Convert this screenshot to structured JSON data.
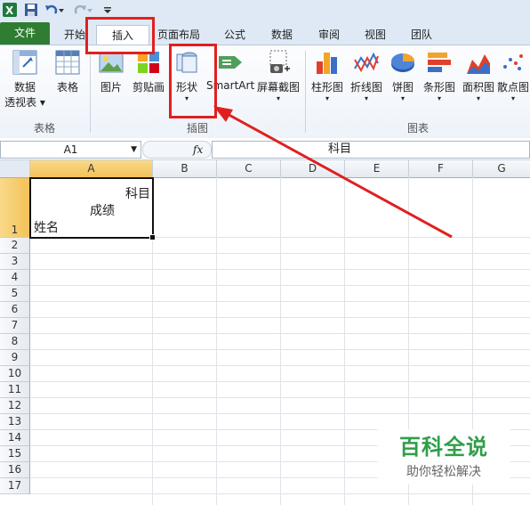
{
  "qat": {
    "icons": [
      "excel-logo-icon",
      "save-icon",
      "undo-icon",
      "redo-icon",
      "customize-icon"
    ]
  },
  "ribbon_tabs": [
    {
      "label": "文件"
    },
    {
      "label": "开始"
    },
    {
      "label": "插入"
    },
    {
      "label": "页面布局"
    },
    {
      "label": "公式"
    },
    {
      "label": "数据"
    },
    {
      "label": "审阅"
    },
    {
      "label": "视图"
    },
    {
      "label": "团队"
    }
  ],
  "ribbon": {
    "groups": [
      {
        "label": "表格",
        "buttons": [
          {
            "line1": "数据",
            "line2": "透视表 ▾"
          },
          {
            "line1": "表格",
            "line2": ""
          }
        ]
      },
      {
        "label": "插图",
        "buttons": [
          {
            "line1": "图片"
          },
          {
            "line1": "剪贴画"
          },
          {
            "line1": "形状",
            "line2": "▾"
          },
          {
            "line1": "SmartArt"
          },
          {
            "line1": "屏幕截图",
            "line2": "▾"
          }
        ]
      },
      {
        "label": "图表",
        "buttons": [
          {
            "line1": "柱形图",
            "line2": "▾"
          },
          {
            "line1": "折线图",
            "line2": "▾"
          },
          {
            "line1": "饼图",
            "line2": "▾"
          },
          {
            "line1": "条形图",
            "line2": "▾"
          },
          {
            "line1": "面积图",
            "line2": "▾"
          },
          {
            "line1": "散点图",
            "line2": "▾"
          }
        ]
      }
    ]
  },
  "formula_bar": {
    "name_box": "A1",
    "fx_label": "fx",
    "content": "科目"
  },
  "columns": [
    "A",
    "B",
    "C",
    "D",
    "E",
    "F",
    "G"
  ],
  "rows": [
    "1",
    "2",
    "3",
    "4",
    "5",
    "6",
    "7",
    "8",
    "9",
    "10",
    "11",
    "12",
    "13",
    "14",
    "15",
    "16",
    "17"
  ],
  "cell_a1": {
    "line1": "科目",
    "line2": "成绩",
    "line3": "姓名"
  },
  "watermark": {
    "title": "百科全说",
    "subtitle": "助你轻松解决"
  },
  "colors": {
    "annotation": "#e02020",
    "file_tab": "#2e7d32",
    "selection_header": "#f3c258"
  }
}
